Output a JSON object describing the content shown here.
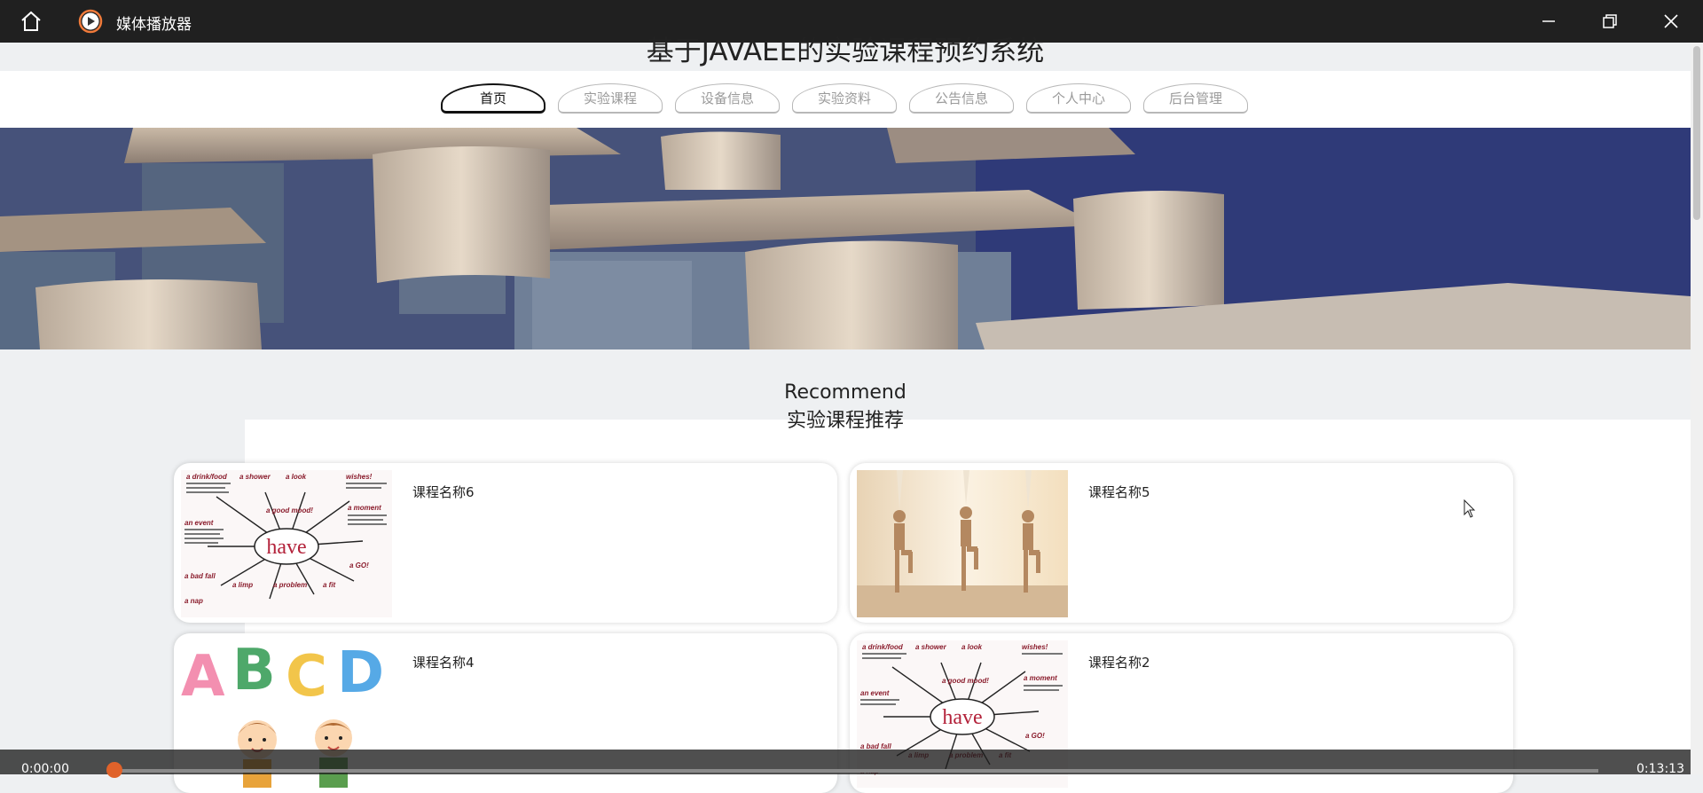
{
  "player": {
    "title": "媒体播放器",
    "time_current": "0:00:00",
    "time_total": "0:13:13",
    "progress_fraction": 0.0
  },
  "site": {
    "title": "基于JAVAEE的实验课程预约系统"
  },
  "nav": {
    "items": [
      "首页",
      "实验课程",
      "设备信息",
      "实验资料",
      "公告信息",
      "个人中心",
      "后台管理"
    ],
    "active_index": 0
  },
  "recommend": {
    "title_en": "Recommend",
    "title_cn": "实验课程推荐",
    "courses": [
      {
        "name": "课程名称6",
        "image": "have-mindmap"
      },
      {
        "name": "课程名称5",
        "image": "yoga-class"
      },
      {
        "name": "课程名称4",
        "image": "abcd-kids"
      },
      {
        "name": "课程名称2",
        "image": "have-mindmap"
      }
    ]
  },
  "mindmap": {
    "center": "have",
    "labels": [
      "a drink/food",
      "a shower",
      "a look",
      "wishes!",
      "a good mood!",
      "a moment",
      "an event",
      "a GO!",
      "a bad fall",
      "a limp",
      "a problem",
      "a fit",
      "a nap"
    ]
  },
  "abcd": [
    "A",
    "B",
    "C",
    "D"
  ],
  "colors": {
    "accent_knob": "#e0622a",
    "active_border": "#111111",
    "inactive_border": "#b8b8b8"
  }
}
